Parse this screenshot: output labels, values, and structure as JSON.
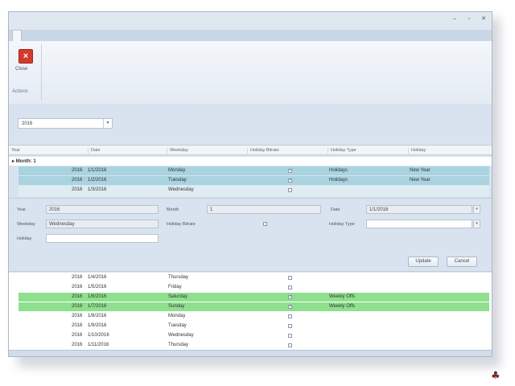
{
  "ribbon": {
    "close_label": "Close",
    "group_label": "Actions"
  },
  "filter": {
    "year_value": "2016"
  },
  "grid": {
    "headers": [
      "Year",
      "Date",
      "Weekday",
      "Holiday Bitrate",
      "Holiday Type",
      "Holiday"
    ],
    "group_label": "Month: 1",
    "top_rows": [
      {
        "year": "2016",
        "date": "1/1/2016",
        "weekday": "Monday",
        "checked": true,
        "type": "Holidays",
        "holiday": "New Year"
      },
      {
        "year": "2016",
        "date": "1/2/2016",
        "weekday": "Tuesday",
        "checked": true,
        "type": "Holidays",
        "holiday": "New Year"
      },
      {
        "year": "2016",
        "date": "1/3/2016",
        "weekday": "Wednesday",
        "checked": false,
        "type": "",
        "holiday": ""
      }
    ],
    "lower_rows": [
      {
        "year": "2016",
        "date": "1/4/2016",
        "weekday": "Thursday",
        "checked": false,
        "type": ""
      },
      {
        "year": "2016",
        "date": "1/5/2016",
        "weekday": "Friday",
        "checked": false,
        "type": ""
      },
      {
        "year": "2016",
        "date": "1/6/2016",
        "weekday": "Saturday",
        "checked": true,
        "type": "Weekly Offs"
      },
      {
        "year": "2016",
        "date": "1/7/2016",
        "weekday": "Sunday",
        "checked": true,
        "type": "Weekly Offs"
      },
      {
        "year": "2016",
        "date": "1/8/2016",
        "weekday": "Monday",
        "checked": false,
        "type": ""
      },
      {
        "year": "2016",
        "date": "1/9/2016",
        "weekday": "Tuesday",
        "checked": false,
        "type": ""
      },
      {
        "year": "2016",
        "date": "1/10/2016",
        "weekday": "Wednesday",
        "checked": false,
        "type": ""
      },
      {
        "year": "2016",
        "date": "1/11/2016",
        "weekday": "Thursday",
        "checked": false,
        "type": ""
      }
    ]
  },
  "detail": {
    "year_label": "Year",
    "year_value": "2016",
    "month_label": "Month",
    "month_value": "1",
    "date_label": "Date",
    "date_value": "1/1/2016",
    "weekday_label": "Weekday",
    "weekday_value": "Wednesday",
    "holiday_bitrate_label": "Holiday Bitrate",
    "holiday_type_label": "Holiday Type",
    "holiday_label": "Holiday",
    "update_label": "Update",
    "cancel_label": "Cancel"
  },
  "colors": {
    "selected_row": "#a9d3e0",
    "weekly_off_row": "#8ee08e",
    "close_button": "#d33a2c"
  }
}
